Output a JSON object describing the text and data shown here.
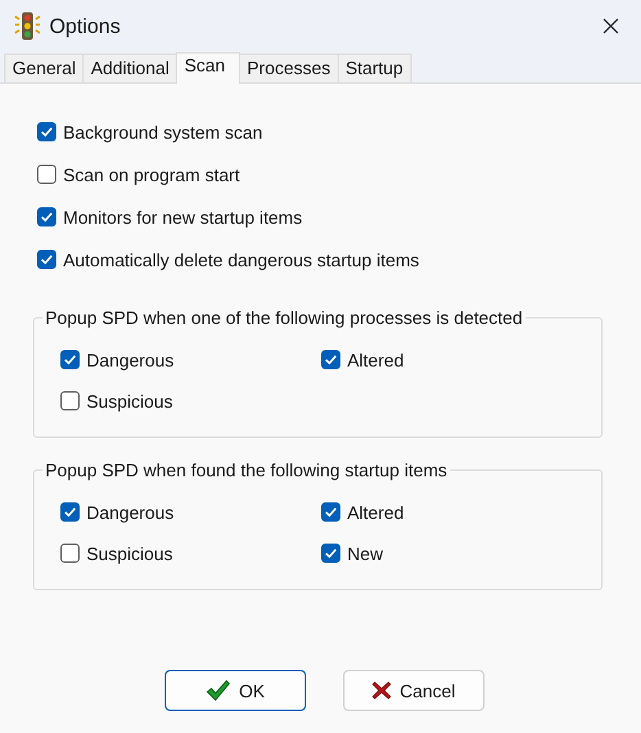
{
  "window": {
    "title": "Options"
  },
  "tabs": [
    {
      "label": "General",
      "selected": false
    },
    {
      "label": "Additional",
      "selected": false
    },
    {
      "label": "Scan",
      "selected": true
    },
    {
      "label": "Processes",
      "selected": false
    },
    {
      "label": "Startup",
      "selected": false
    }
  ],
  "options": [
    {
      "label": "Background system scan",
      "checked": true
    },
    {
      "label": "Scan on program start",
      "checked": false
    },
    {
      "label": "Monitors for new startup items",
      "checked": true
    },
    {
      "label": "Automatically delete dangerous startup items",
      "checked": true
    }
  ],
  "groups": [
    {
      "title": "Popup SPD when one of the following processes is detected",
      "items": [
        {
          "label": "Dangerous",
          "checked": true
        },
        {
          "label": "Altered",
          "checked": true
        },
        {
          "label": "Suspicious",
          "checked": false
        }
      ]
    },
    {
      "title": "Popup SPD when found the following startup items",
      "items": [
        {
          "label": "Dangerous",
          "checked": true
        },
        {
          "label": "Altered",
          "checked": true
        },
        {
          "label": "Suspicious",
          "checked": false
        },
        {
          "label": "New",
          "checked": true
        }
      ]
    }
  ],
  "buttons": [
    {
      "label": "OK",
      "kind": "ok"
    },
    {
      "label": "Cancel",
      "kind": "cancel"
    }
  ]
}
